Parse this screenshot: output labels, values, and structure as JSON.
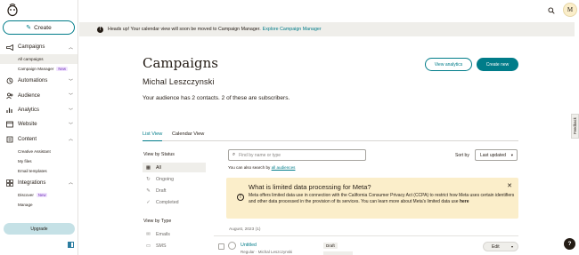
{
  "sidebar": {
    "create_label": "Create",
    "items": [
      {
        "label": "Campaigns",
        "icon": "megaphone-icon"
      },
      {
        "label": "Automations",
        "icon": "automation-icon"
      },
      {
        "label": "Audience",
        "icon": "people-icon"
      },
      {
        "label": "Analytics",
        "icon": "chart-icon"
      },
      {
        "label": "Website",
        "icon": "globe-icon"
      },
      {
        "label": "Content",
        "icon": "content-icon"
      },
      {
        "label": "Integrations",
        "icon": "integrations-icon"
      }
    ],
    "campaign_subs": [
      "All campaigns",
      "Campaign Manager"
    ],
    "content_subs": [
      "Creative Assistant",
      "My files",
      "Email templates"
    ],
    "integration_subs": [
      "Discover",
      "Manage"
    ],
    "new_badge": "New",
    "upgrade_label": "Upgrade"
  },
  "topbar": {
    "avatar_initial": "M"
  },
  "banner": {
    "text": "Heads up! Your calendar view will soon be moved to Campaign Manager.",
    "link": "Explore Campaign Manager"
  },
  "header": {
    "title": "Campaigns",
    "account_name": "Michal Leszczynski",
    "audience_note": "Your audience has 2 contacts. 2 of these are subscribers.",
    "view_analytics_label": "View analytics",
    "create_new_label": "Create new"
  },
  "tabs": {
    "list_view": "List View",
    "calendar_view": "Calendar View"
  },
  "filters": {
    "status_heading": "View by Status",
    "status_items": [
      "All",
      "Ongoing",
      "Draft",
      "Completed"
    ],
    "type_heading": "View by Type",
    "type_items": [
      "Emails",
      "SMS"
    ]
  },
  "search": {
    "placeholder": "Find by name or type",
    "hint": "You can also search by",
    "hint_link": "all audiences"
  },
  "sort": {
    "label": "Sort by",
    "value": "Last updated"
  },
  "notice": {
    "title": "What is limited data processing for Meta?",
    "body": "Meta offers limited data use in connection with the California Consumer Privacy Act (CCPA) to restrict how Meta uses certain identifiers and other data processed in the provision of its services. You can learn more about Meta's limited data use",
    "link": "here"
  },
  "campaigns": {
    "month": "August, 2023 (1)",
    "rows": [
      {
        "name": "Untitled",
        "meta": "Regular · Michal Leszczynski",
        "status": "Draft",
        "action": "Edit"
      }
    ]
  },
  "feedback_label": "Feedback",
  "help_label": "?",
  "colors": {
    "accent": "#007c89",
    "banner_bg": "#efeeea",
    "notice_bg": "#fbeeca"
  }
}
